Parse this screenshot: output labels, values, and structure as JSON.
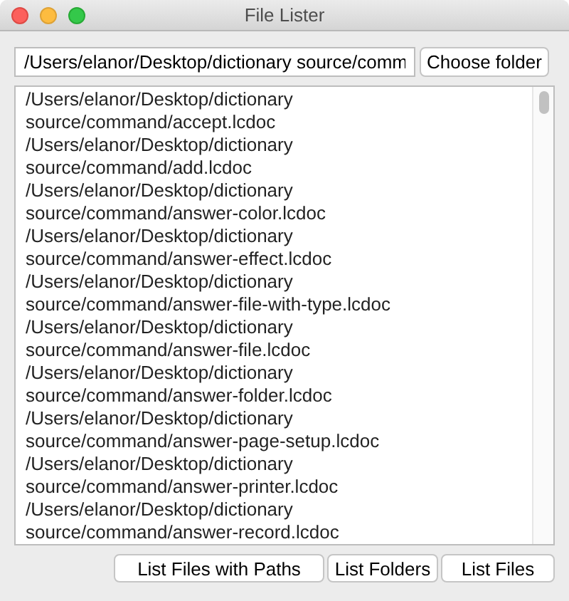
{
  "window": {
    "title": "File Lister"
  },
  "folder_field": {
    "value": "/Users/elanor/Desktop/dictionary source/comm"
  },
  "choose_button": "Choose folder",
  "file_list": [
    "/Users/elanor/Desktop/dictionary",
    "source/command/accept.lcdoc",
    "/Users/elanor/Desktop/dictionary",
    "source/command/add.lcdoc",
    "/Users/elanor/Desktop/dictionary",
    "source/command/answer-color.lcdoc",
    "/Users/elanor/Desktop/dictionary",
    "source/command/answer-effect.lcdoc",
    "/Users/elanor/Desktop/dictionary",
    "source/command/answer-file-with-type.lcdoc",
    "/Users/elanor/Desktop/dictionary",
    "source/command/answer-file.lcdoc",
    "/Users/elanor/Desktop/dictionary",
    "source/command/answer-folder.lcdoc",
    "/Users/elanor/Desktop/dictionary",
    "source/command/answer-page-setup.lcdoc",
    "/Users/elanor/Desktop/dictionary",
    "source/command/answer-printer.lcdoc",
    "/Users/elanor/Desktop/dictionary",
    "source/command/answer-record.lcdoc"
  ],
  "buttons": [
    "List Files with Paths",
    "List Folders",
    "List Files"
  ]
}
